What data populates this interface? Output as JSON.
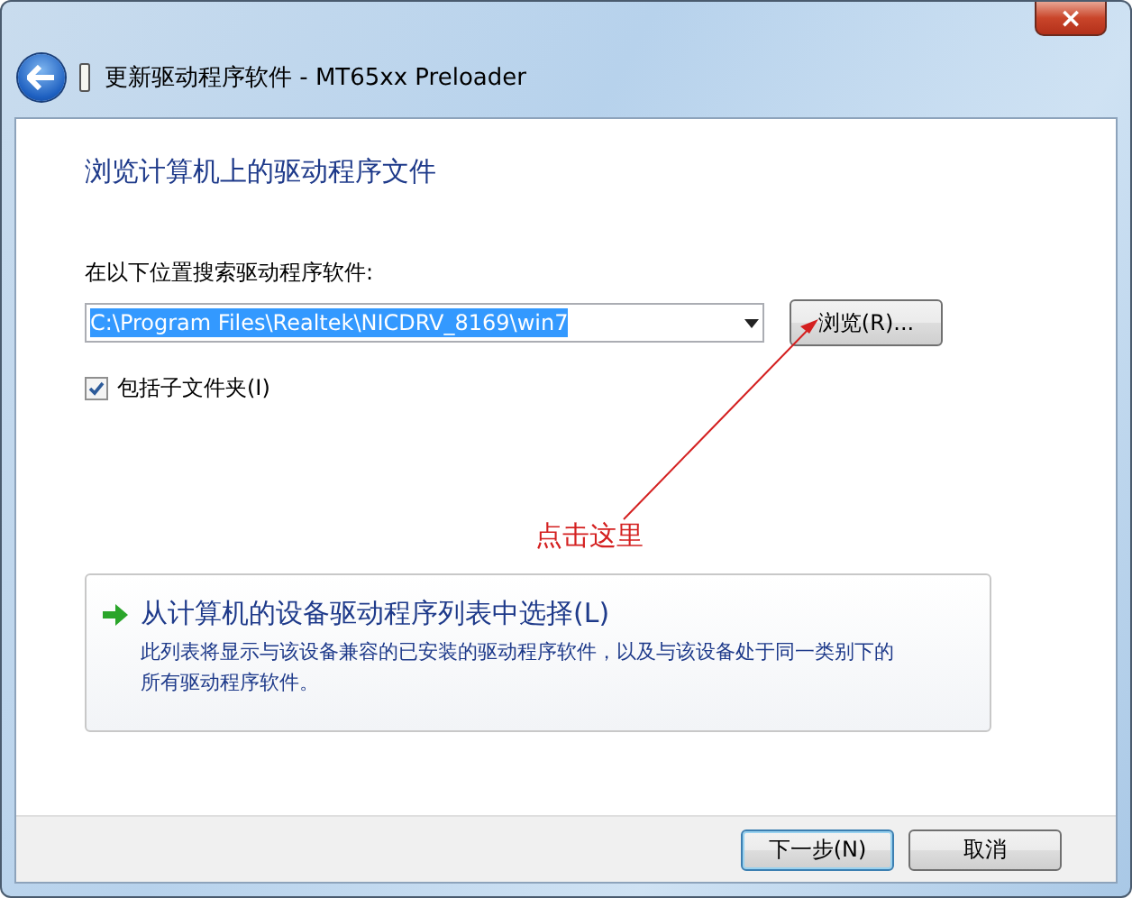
{
  "window": {
    "title": "更新驱动程序软件 - MT65xx Preloader",
    "close_label": "×"
  },
  "heading": "浏览计算机上的驱动程序文件",
  "search": {
    "label": "在以下位置搜索驱动程序软件:",
    "value": "C:\\Program Files\\Realtek\\NICDRV_8169\\win7",
    "text_selected": true,
    "browse_button": "浏览(R)..."
  },
  "include_subfolders": {
    "label": "包括子文件夹(I)",
    "checked": true
  },
  "annotation": {
    "text": "点击这里"
  },
  "option": {
    "title": "从计算机的设备驱动程序列表中选择(L)",
    "description": "此列表将显示与该设备兼容的已安装的驱动程序软件，以及与该设备处于同一类别下的所有驱动程序软件。"
  },
  "buttons": [
    {
      "label": "下一步(N)",
      "default": true
    },
    {
      "label": "取消",
      "default": false
    }
  ]
}
